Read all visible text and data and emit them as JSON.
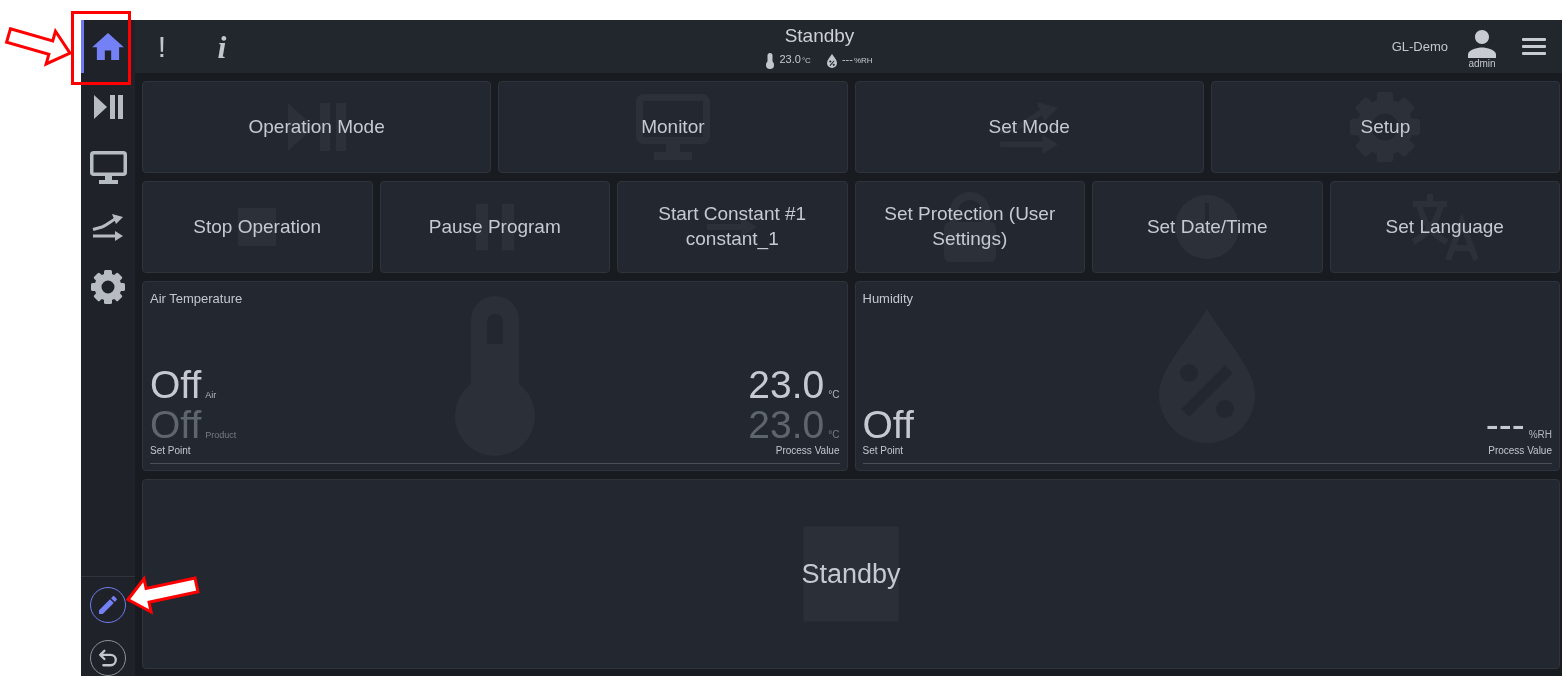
{
  "sidebar": {
    "items": [
      {
        "selected": true
      },
      {
        "selected": false
      },
      {
        "selected": false
      },
      {
        "selected": false
      },
      {
        "selected": false
      }
    ],
    "tools": [
      {
        "selected": true
      },
      {
        "selected": false
      }
    ]
  },
  "top_bar": {
    "buttons": [
      "!",
      "i"
    ],
    "status": "Standby",
    "readings": [
      {
        "value": "23.0",
        "unit": "°C"
      },
      {
        "value": "---",
        "unit": "%RH"
      }
    ],
    "device_name": "GL-Demo",
    "user": "admin"
  },
  "actions": [
    {
      "label": "Operation Mode"
    },
    {
      "label": "Monitor"
    },
    {
      "label": "Set Mode"
    },
    {
      "label": "Setup"
    }
  ],
  "quick_actions": [
    {
      "label": "Stop Operation"
    },
    {
      "label": "Pause Program"
    },
    {
      "label": "Start Constant #1 constant_1"
    },
    {
      "label": "Set Protection (User Settings)"
    },
    {
      "label": "Set Date/Time"
    },
    {
      "label": "Set Language"
    }
  ],
  "panels": [
    {
      "title": "Air Temperature",
      "set_points": [
        {
          "value": "Off",
          "name": "Air",
          "dimmed": false
        },
        {
          "value": "Off",
          "name": "Product",
          "dimmed": true
        }
      ],
      "set_point_label": "Set Point",
      "process_values": [
        {
          "value": "23.0",
          "unit": "°C",
          "dimmed": false
        },
        {
          "value": "23.0",
          "unit": "°C",
          "dimmed": true
        }
      ],
      "process_value_label": "Process Value"
    },
    {
      "title": "Humidity",
      "set_points": [
        {
          "value": "Off",
          "dimmed": false
        }
      ],
      "set_point_label": "Set Point",
      "process_values": [
        {
          "value": "---",
          "unit": "%RH",
          "dimmed": false
        }
      ],
      "process_value_label": "Process Value"
    }
  ],
  "status_panel": {
    "text": "Standby"
  }
}
